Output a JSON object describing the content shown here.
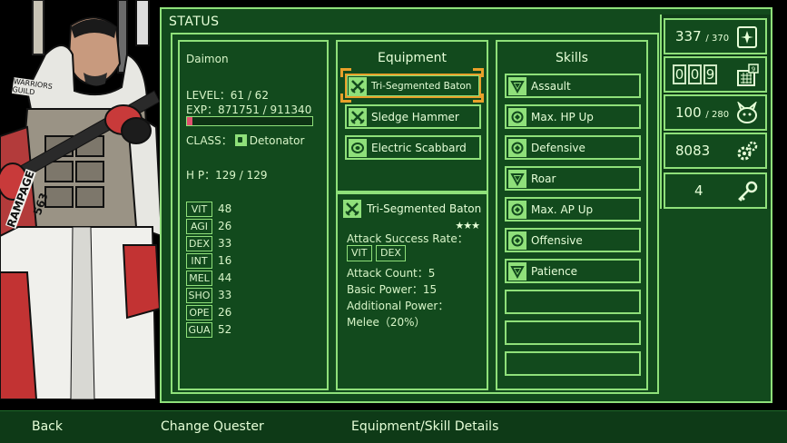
{
  "window": {
    "title": "STATUS"
  },
  "character": {
    "name": "Daimon",
    "level_label": "LEVEL：61 / 62",
    "exp_label": "EXP：871751 / 911340",
    "exp_fraction": 0.04,
    "class_label": "CLASS：",
    "class_value": "Detonator",
    "hp_label": "H P：129 / 129",
    "stats": [
      {
        "label": "VIT",
        "value": "48"
      },
      {
        "label": "AGI",
        "value": "26"
      },
      {
        "label": "DEX",
        "value": "33"
      },
      {
        "label": "INT",
        "value": "16"
      },
      {
        "label": "MEL",
        "value": "44"
      },
      {
        "label": "SHO",
        "value": "33"
      },
      {
        "label": "OPE",
        "value": "26"
      },
      {
        "label": "GUA",
        "value": "52"
      }
    ],
    "badge_line1": "WARRIORS",
    "badge_line2": "GUILD",
    "badge_line3": "RAMPAGE",
    "badge_line4": "563"
  },
  "equipment": {
    "title": "Equipment",
    "items": [
      {
        "label": "Tri-Segmented Baton",
        "icon": "crossed-swords-icon",
        "selected": true
      },
      {
        "label": "Sledge Hammer",
        "icon": "crossed-swords-icon",
        "selected": false
      },
      {
        "label": "Electric Scabbard",
        "icon": "shield-icon",
        "selected": false
      }
    ]
  },
  "detail": {
    "name": "Tri-Segmented Baton",
    "stars": "★★★",
    "attack_success_label": "Attack Success Rate：",
    "tags": [
      "VIT",
      "DEX"
    ],
    "attack_count": "Attack Count：5",
    "basic_power": "Basic Power：15",
    "additional_power_label": "Additional Power：",
    "additional_power_value": "Melee（20%）"
  },
  "skills": {
    "title": "Skills",
    "items": [
      {
        "label": "Assault",
        "icon": "triangle-icon"
      },
      {
        "label": "Max. HP Up",
        "icon": "circle-arrows-icon"
      },
      {
        "label": "Defensive",
        "icon": "circle-arrows-icon"
      },
      {
        "label": "Roar",
        "icon": "triangle-icon"
      },
      {
        "label": "Max. AP Up",
        "icon": "circle-arrows-icon"
      },
      {
        "label": "Offensive",
        "icon": "circle-arrows-icon"
      },
      {
        "label": "Patience",
        "icon": "triangle-icon"
      }
    ],
    "empty_slots": 3
  },
  "resources": {
    "cards": {
      "value": "337",
      "max": "/ 370",
      "icon": "sparkle-card-icon"
    },
    "days": {
      "digits": [
        "0",
        "0",
        "9"
      ],
      "badge": "9",
      "icon": "calendar-icon"
    },
    "monsters": {
      "value": "100",
      "max": "/ 280",
      "icon": "creature-icon"
    },
    "parts": {
      "value": "8083",
      "icon": "gears-icon"
    },
    "keys": {
      "value": "4",
      "icon": "key-icon"
    }
  },
  "bottom_bar": {
    "back": "Back",
    "change": "Change Quester",
    "details": "Equipment/Skill Details"
  },
  "colors": {
    "panel_bg": "#124a1d",
    "border": "#8fe07a",
    "selection": "#e8a02a",
    "exp_fill": "#e0506e"
  }
}
